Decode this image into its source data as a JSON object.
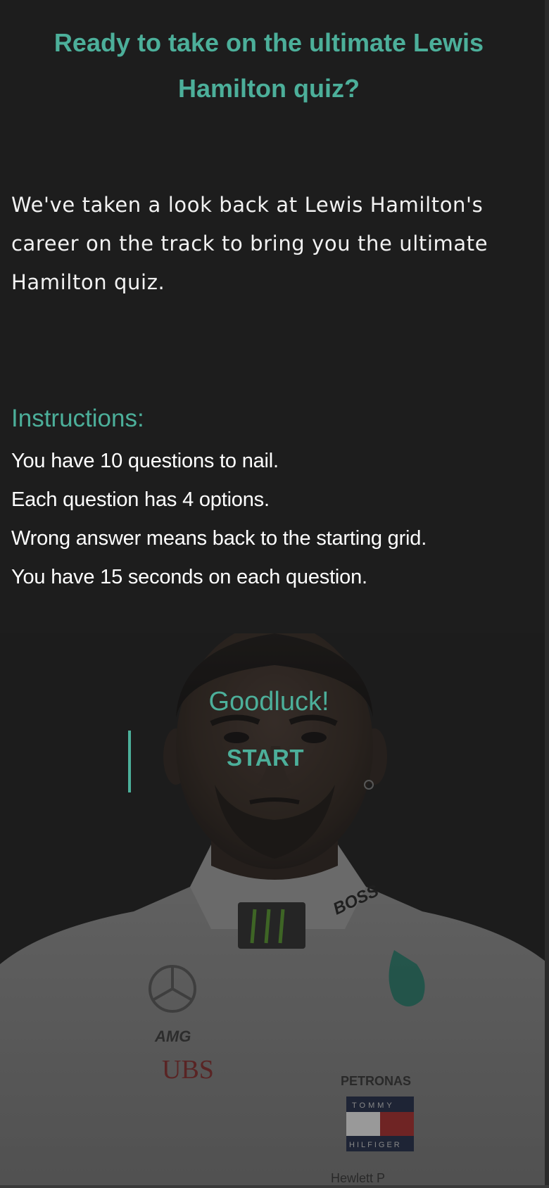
{
  "header": {
    "title": "Ready to take on the ultimate Lewis Hamilton quiz?"
  },
  "intro": {
    "text": "We've taken a look back at Lewis Hamilton's career on the track to bring you the ultimate Hamilton quiz."
  },
  "instructions": {
    "title": "Instructions:",
    "items": [
      "You have 10 questions to nail.",
      "Each question has 4 options.",
      "Wrong answer means back to the starting grid.",
      "You have 15 seconds on each question."
    ]
  },
  "footer": {
    "goodluck": "Goodluck!",
    "start_label": "START"
  },
  "portrait": {
    "collar_brand": "BOSS",
    "sponsor_amg": "AMG",
    "sponsor_ubs": "UBS",
    "sponsor_petronas": "PETRONAS",
    "sponsor_tommy_top": "TOMMY",
    "sponsor_tommy_bottom": "HILFIGER",
    "sponsor_hp": "Hewlett P"
  },
  "colors": {
    "accent": "#4caf9a",
    "background": "#1d1d1d",
    "text": "#ffffff"
  }
}
